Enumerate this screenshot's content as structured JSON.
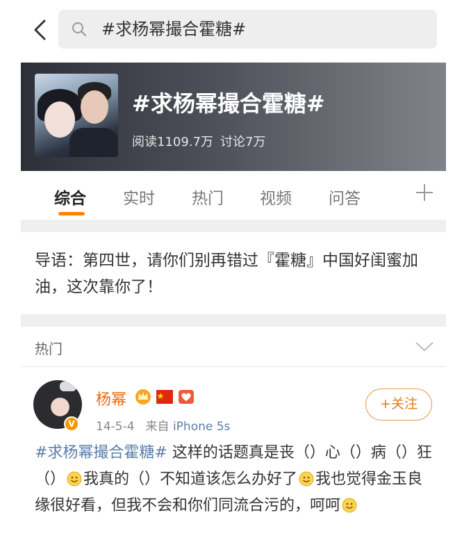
{
  "search": {
    "query": "#求杨幂撮合霍糖#"
  },
  "topic": {
    "title": "#求杨幂撮合霍糖#",
    "reads": "阅读1109.7万",
    "discussions": "讨论7万"
  },
  "tabs": [
    {
      "label": "综合",
      "active": true
    },
    {
      "label": "实时",
      "active": false
    },
    {
      "label": "热门",
      "active": false
    },
    {
      "label": "视频",
      "active": false
    },
    {
      "label": "问答",
      "active": false
    }
  ],
  "intro": {
    "text": "导语：第四世，请你们别再错过『霍糖』中国好闺蜜加油，这次靠你了！"
  },
  "section": {
    "label": "热门"
  },
  "post": {
    "username": "杨幂",
    "date": "14-5-4",
    "source_prefix": "来自",
    "device": "iPhone 5s",
    "follow_label": "+关注",
    "topic_tag": "#求杨幂撮合霍糖#",
    "text_part1": " 这样的话题真是丧（）心（）病（）狂（）",
    "text_part2": "我真的（）不知道该怎么办好了",
    "text_part3": "我也觉得金玉良缘很好看，但我不会和你们同流合污的，呵呵"
  },
  "colors": {
    "accent_orange": "#ff8200",
    "link_blue": "#5b7ea8",
    "username_orange": "#e86b10"
  },
  "icons": [
    "back-arrow-icon",
    "search-icon",
    "plus-icon",
    "chevron-down-icon",
    "crown-icon",
    "china-flag-icon",
    "heart-badge-icon",
    "verified-icon",
    "smile-emoji-icon"
  ]
}
